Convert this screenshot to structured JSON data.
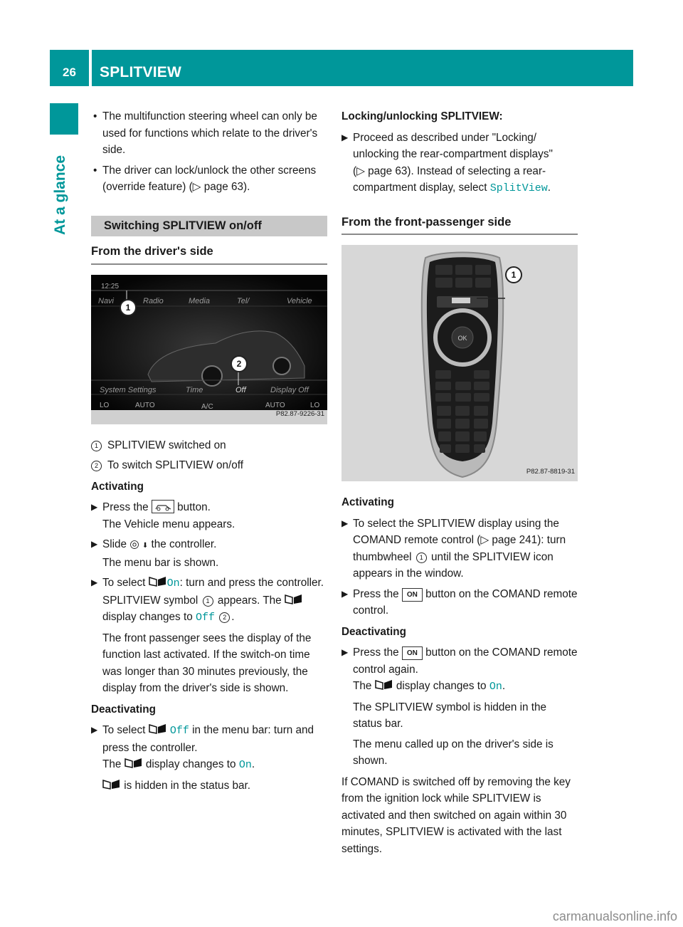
{
  "header": {
    "page_number": "26",
    "section_title": "SPLITVIEW",
    "side_label": "At a glance",
    "accent_color": "#00979a"
  },
  "left": {
    "bullets": [
      "The multifunction steering wheel can only be used for functions which relate to the driver's side.",
      {
        "before": "The driver can lock/unlock the other screens (override feature) (",
        "ref": "page 63",
        "after": ")."
      }
    ],
    "section_heading": "Switching SPLITVIEW on/off",
    "subheading": "From the driver's side",
    "figure": {
      "time": "12:25",
      "menu": [
        "Navi",
        "Radio",
        "Media",
        "Tel/",
        "Vehicle"
      ],
      "bottom_menu": [
        "System Settings",
        "Time",
        "Off",
        "Display Off"
      ],
      "climate": [
        "LO",
        "AUTO",
        "A/C",
        "AUTO",
        "LO"
      ],
      "callouts": [
        "1",
        "2"
      ],
      "code": "P82.87-9226-31"
    },
    "legend": [
      {
        "num": "1",
        "text": "SPLITVIEW switched on"
      },
      {
        "num": "2",
        "text": "To switch SPLITVIEW on/off"
      }
    ],
    "activating": {
      "label": "Activating",
      "step1_a": "Press the",
      "step1_b": "button.",
      "step1_result": "The Vehicle menu appears.",
      "step2_a": "Slide",
      "step2_b": "the controller.",
      "step2_result": "The menu bar is shown.",
      "step3_a": "To select",
      "step3_on": "On",
      "step3_b": ": turn and press the controller.",
      "step3_r1": "SPLITVIEW symbol",
      "step3_r2": "appears. The",
      "step3_r3": "display changes to",
      "step3_off": "Off",
      "step3_note": "The front passenger sees the display of the function last activated. If the switch-on time was longer than 30 minutes previously, the display from the driver's side is shown."
    },
    "deactivating": {
      "label": "Deactivating",
      "a": "To select",
      "off": "Off",
      "b": "in the menu bar: turn and press the controller.",
      "r1": "The",
      "r2": "display changes to",
      "on": "On",
      "r3": "is hidden in the status bar."
    }
  },
  "right": {
    "locking_label": "Locking/unlocking SPLITVIEW:",
    "locking_a": "Proceed as described under \"Locking/ unlocking the rear-compartment displays\" (",
    "locking_ref": "page 63",
    "locking_b": "). Instead of selecting a rear-compartment display, select",
    "locking_value": "SplitView",
    "subheading": "From the front-passenger side",
    "figure": {
      "code": "P82.87-8819-31",
      "callout": "1"
    },
    "activating": {
      "label": "Activating",
      "s1_a": "To select the SPLITVIEW display using the COMAND remote control (",
      "s1_ref": "page 241",
      "s1_b": "): turn thumbwheel",
      "s1_c": "until the SPLITVIEW icon appears in the window.",
      "s2_a": "Press the",
      "s2_key": "ON",
      "s2_b": "button on the COMAND remote control."
    },
    "deactivating": {
      "label": "Deactivating",
      "a": "Press the",
      "key": "ON",
      "b": "button on the COMAND remote control again.",
      "r1": "The",
      "r2": "display changes to",
      "on": "On",
      "r3": "The SPLITVIEW symbol is hidden in the status bar.",
      "r4": "The menu called up on the driver's side is shown."
    },
    "closing": "If COMAND is switched off by removing the key from the ignition lock while SPLITVIEW is activated and then switched on again within 30 minutes, SPLITVIEW is activated with the last settings."
  },
  "watermark": "carmanualsonline.info"
}
